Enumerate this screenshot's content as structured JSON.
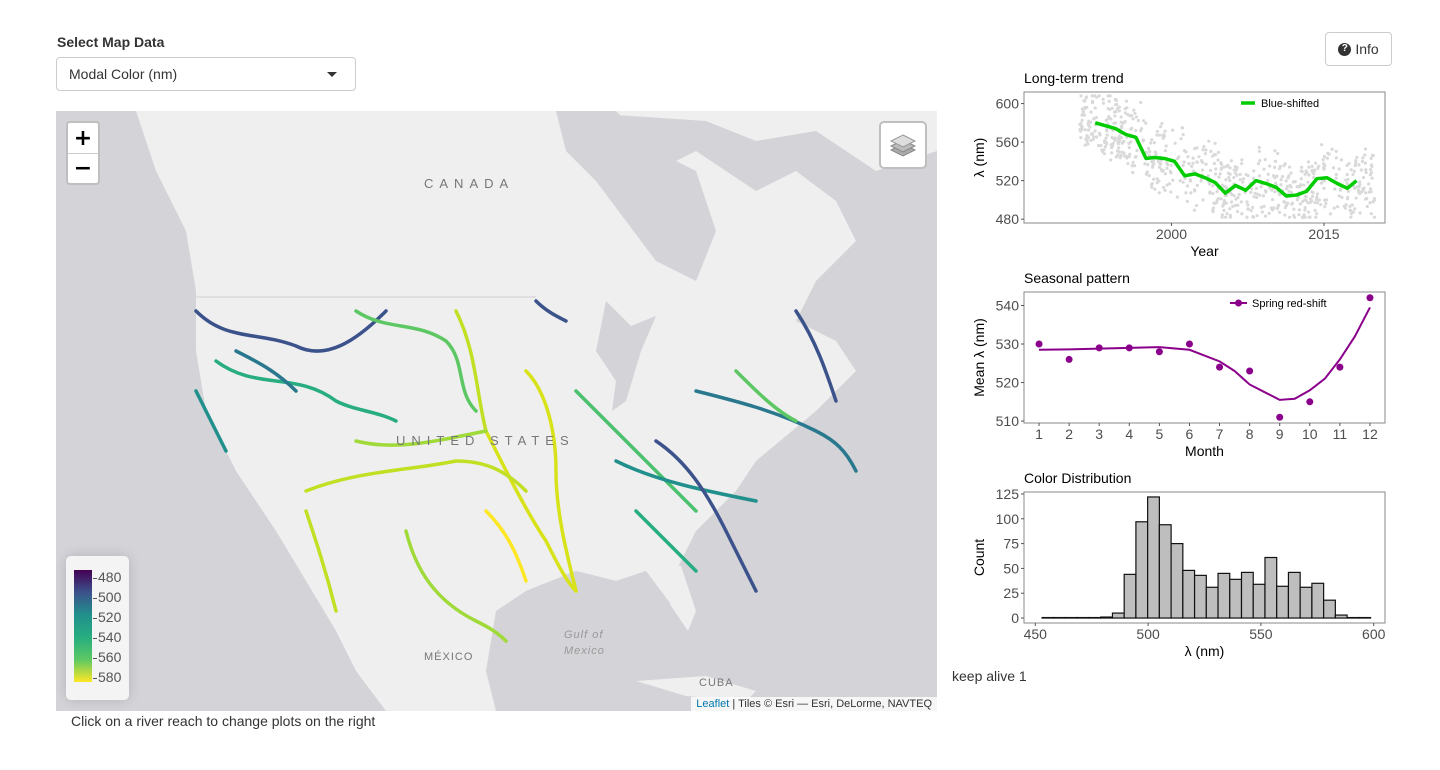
{
  "controls": {
    "select_label": "Select Map Data",
    "select_value": "Modal Color (nm)",
    "info_label": "Info"
  },
  "map": {
    "labels": {
      "canada": "CANADA",
      "united_states": "UNITED STATES",
      "mexico": "MÉXICO",
      "gulf": "Gulf of",
      "gulf2": "Mexico",
      "cuba": "CUBA"
    },
    "zoom_in": "+",
    "zoom_out": "−",
    "legend": {
      "ticks": [
        "480",
        "500",
        "520",
        "540",
        "560",
        "580"
      ],
      "colors": [
        "#440154",
        "#3b528b",
        "#21908c",
        "#27ad81",
        "#5dc863",
        "#fde725"
      ]
    },
    "attribution": {
      "link": "Leaflet",
      "text": " | Tiles © Esri — Esri, DeLorme, NAVTEQ"
    }
  },
  "caption": "Click on a river reach to change plots on the right",
  "keep_alive": "keep alive 1",
  "chart_data": [
    {
      "type": "line",
      "title": "Long-term trend",
      "xlabel": "Year",
      "ylabel": "λ (nm)",
      "xlim": [
        1985.5,
        2021
      ],
      "ylim": [
        476,
        612
      ],
      "xticks": [
        2000,
        2015
      ],
      "yticks": [
        480,
        520,
        560,
        600
      ],
      "legend": {
        "label": "Blue-shifted",
        "position": "top-right"
      },
      "color": "#00cc00",
      "scatter_color": "#d9d9d9",
      "series": [
        {
          "name": "Blue-shifted",
          "x": [
            1992.5,
            1993.5,
            1994.5,
            1995.5,
            1996.5,
            1997.5,
            1998.3,
            1999.3,
            2000.3,
            2001.3,
            2002.3,
            2003.3,
            2004.3,
            2005.3,
            2006.3,
            2007.3,
            2008.3,
            2009.3,
            2010.3,
            2011.3,
            2012.3,
            2013.3,
            2014.3,
            2015.3,
            2016.3,
            2017.3,
            2018.2
          ],
          "y": [
            580,
            577,
            574,
            568,
            565,
            543,
            544,
            543,
            540,
            525,
            527,
            523,
            518,
            507,
            515,
            510,
            520,
            517,
            513,
            504,
            505,
            509,
            522,
            523,
            517,
            512,
            520
          ]
        }
      ]
    },
    {
      "type": "scatter",
      "title": "Seasonal pattern",
      "xlabel": "Month",
      "ylabel": "Mean λ (nm)",
      "xlim": [
        0.5,
        12.5
      ],
      "ylim": [
        509.5,
        543.5
      ],
      "xticks": [
        1,
        2,
        3,
        4,
        5,
        6,
        7,
        8,
        9,
        10,
        11,
        12
      ],
      "yticks": [
        510,
        520,
        530,
        540
      ],
      "legend": {
        "label": "Spring red-shift",
        "position": "top-right"
      },
      "color": "#8b008b",
      "points": {
        "x": [
          1,
          2,
          3,
          4,
          5,
          6,
          7,
          8,
          9,
          10,
          11,
          12
        ],
        "y": [
          530,
          526,
          529,
          529,
          528,
          530,
          524,
          523,
          511,
          515,
          524,
          542
        ]
      },
      "smooth": {
        "x": [
          1,
          2,
          3,
          4,
          5,
          6,
          7,
          7.5,
          8,
          8.5,
          9,
          9.5,
          10,
          10.5,
          11,
          11.5,
          12
        ],
        "y": [
          528.5,
          528.6,
          528.8,
          529,
          529.2,
          528.5,
          525.5,
          523,
          519.5,
          517.5,
          515.5,
          515.8,
          518,
          521,
          526,
          532,
          539.5
        ]
      }
    },
    {
      "type": "bar",
      "title": "Color Distribution",
      "xlabel": "λ (nm)",
      "ylabel": "Count",
      "xlim": [
        445,
        605
      ],
      "ylim": [
        -5,
        127
      ],
      "xticks": [
        450,
        500,
        550,
        600
      ],
      "yticks": [
        0,
        25,
        50,
        75,
        100,
        125
      ],
      "fill": "#bebebe",
      "bin_width": 5.2,
      "bin_starts": [
        453,
        458.2,
        463.4,
        468.6,
        473.8,
        479,
        484.2,
        489.4,
        494.6,
        499.8,
        505,
        510.2,
        515.4,
        520.6,
        525.8,
        531,
        536.2,
        541.4,
        546.6,
        551.8,
        557,
        562.2,
        567.4,
        572.6,
        577.8,
        583,
        588.2,
        593.4
      ],
      "values": [
        0,
        0,
        0,
        0,
        0,
        1,
        5,
        44,
        97,
        122,
        94,
        75,
        48,
        43,
        31,
        45,
        39,
        46,
        34,
        61,
        32,
        46,
        31,
        35,
        18,
        3,
        0,
        0
      ]
    }
  ]
}
